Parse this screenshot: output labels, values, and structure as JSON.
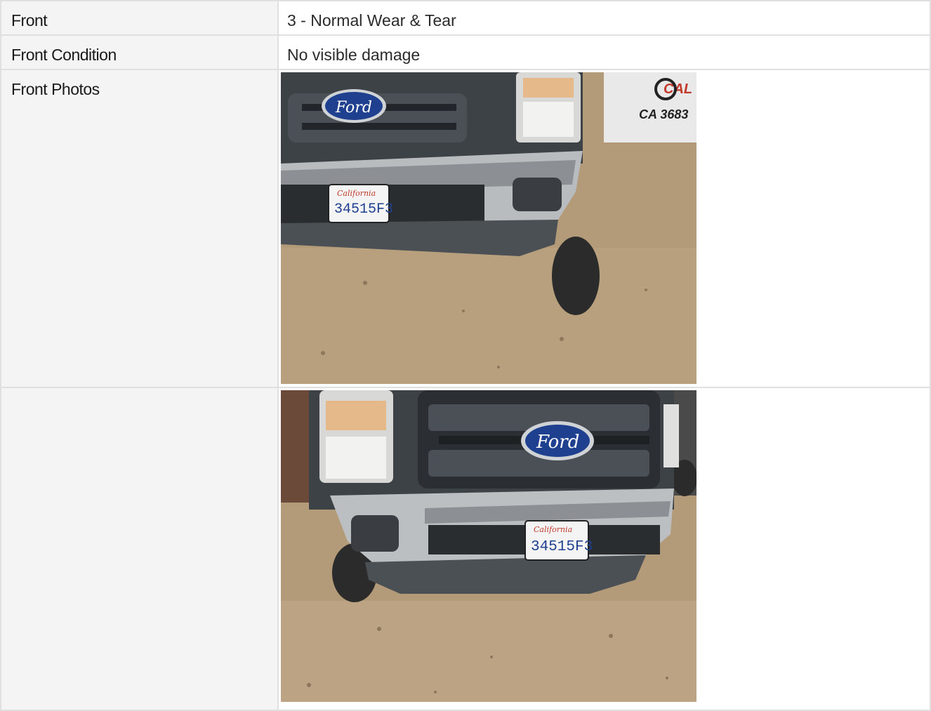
{
  "rows": [
    {
      "label": "Front",
      "value": "3 - Normal Wear & Tear"
    },
    {
      "label": "Front Condition",
      "value": "No visible damage"
    },
    {
      "label": "Front Photos",
      "value": ""
    },
    {
      "label": "",
      "value": ""
    }
  ],
  "photos": [
    {
      "logo_text": "Ford",
      "plate_text": "34515F3",
      "plate_state": "California",
      "sign_brand": "CAL WE",
      "sign_number": "CA 3683"
    },
    {
      "logo_text": "Ford",
      "plate_text": "34515F3",
      "plate_state": "California"
    }
  ]
}
